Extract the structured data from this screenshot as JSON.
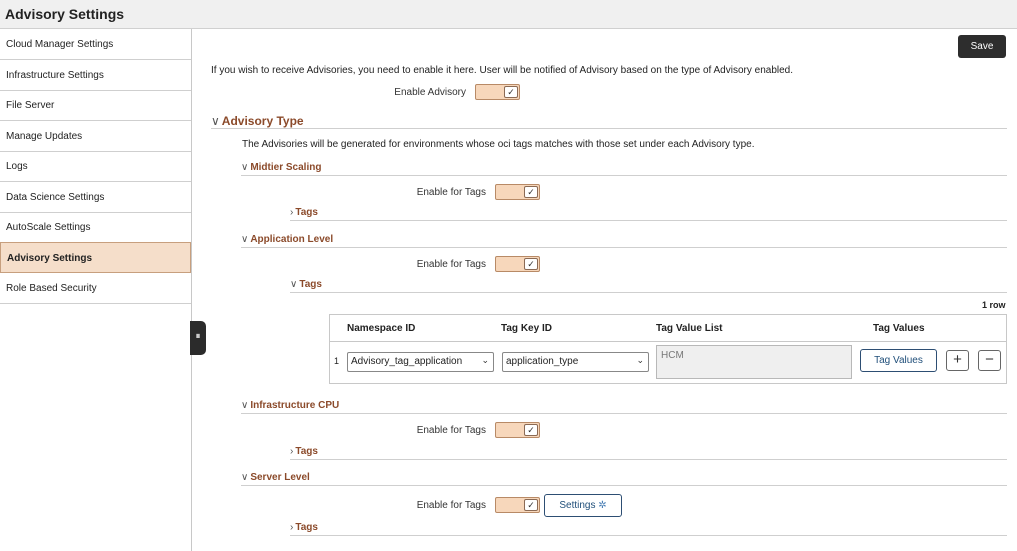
{
  "window": {
    "title": "Advisory Settings"
  },
  "sidebar": {
    "items": [
      {
        "label": "Cloud Manager Settings"
      },
      {
        "label": "Infrastructure Settings"
      },
      {
        "label": "File Server"
      },
      {
        "label": "Manage Updates"
      },
      {
        "label": "Logs"
      },
      {
        "label": "Data Science Settings"
      },
      {
        "label": "AutoScale Settings"
      },
      {
        "label": "Advisory Settings",
        "active": true
      },
      {
        "label": "Role Based Security"
      }
    ],
    "collapse_glyph": "⏸"
  },
  "main": {
    "save_label": "Save",
    "intro": "If you wish to receive Advisories, you need to enable it here. User will be notified of Advisory based on the type of Advisory enabled.",
    "enable_advisory_label": "Enable Advisory",
    "enable_advisory_checked": true,
    "advisory_type": {
      "heading": "Advisory Type",
      "description": "The Advisories will be generated for environments whose oci tags matches with those set under each Advisory type.",
      "sections": [
        {
          "heading": "Midtier Scaling",
          "enable_label": "Enable for Tags",
          "enabled": true,
          "tags_label": "Tags",
          "tags_expanded": false
        },
        {
          "heading": "Application Level",
          "enable_label": "Enable for Tags",
          "enabled": true,
          "tags_label": "Tags",
          "tags_expanded": true,
          "grid": {
            "row_count": "1 row",
            "columns": [
              "Namespace ID",
              "Tag Key ID",
              "Tag Value List",
              "Tag Values"
            ],
            "rows": [
              {
                "num": "1",
                "namespace_id": "Advisory_tag_application",
                "tag_key_id": "application_type",
                "tag_value_list": "HCM",
                "tag_values_button": "Tag Values"
              }
            ],
            "add_glyph": "+",
            "remove_glyph": "−"
          }
        },
        {
          "heading": "Infrastructure CPU",
          "enable_label": "Enable for Tags",
          "enabled": true,
          "tags_label": "Tags",
          "tags_expanded": false
        },
        {
          "heading": "Server Level",
          "enable_label": "Enable for Tags",
          "enabled": true,
          "settings_label": "Settings",
          "tags_label": "Tags",
          "tags_expanded": false
        }
      ]
    }
  },
  "icons": {
    "check": "✓",
    "chevron_down": "∨",
    "chevron_right": "›",
    "gear": "✲",
    "select_caret": "⌄"
  },
  "colors": {
    "accent": "#8b4a2a",
    "toggle_bg": "#f7d7bb",
    "active_nav": "#f5deca",
    "dark_button": "#2d2d2d"
  }
}
